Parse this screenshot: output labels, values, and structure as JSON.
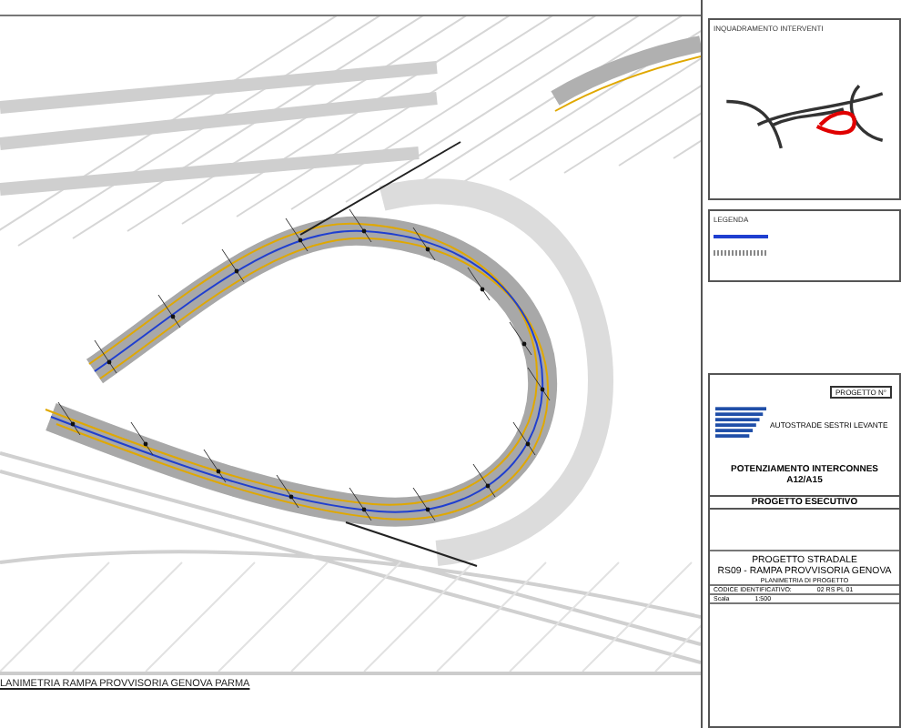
{
  "drawing": {
    "title": "LANIMETRIA RAMPA PROVVISORIA GENOVA PARMA"
  },
  "inset": {
    "title": "INQUADRAMENTO INTERVENTI"
  },
  "legend": {
    "title": "LEGENDA"
  },
  "title_block": {
    "project_no_label": "PROGETTO N°",
    "company": "AUTOSTRADE SESTRI LEVANTE",
    "project": "POTENZIAMENTO INTERCONNES",
    "project_sub": "A12/A15",
    "phase": "PROGETTO ESECUTIVO",
    "subject": "PROGETTO STRADALE",
    "subject_sub": "RS09 - RAMPA PROVVISORIA GENOVA",
    "sheet": "PLANIMETRIA DI PROGETTO",
    "code_label": "CODICE IDENTIFICATIVO:",
    "code": "02 RS PL 01",
    "scale_label": "Scala",
    "scale": "1:500"
  }
}
